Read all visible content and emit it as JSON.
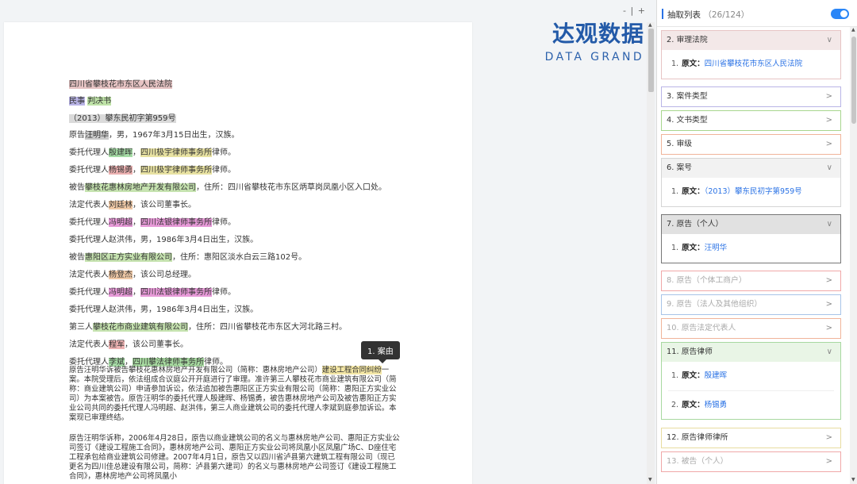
{
  "viewer": {
    "zoom_out": "-",
    "zoom_sep": "|",
    "zoom_in": "+",
    "brand_cn": "达观数据",
    "brand_en": "DATA GRAND",
    "tooltip": "1. 案由"
  },
  "document": {
    "court": "四川省攀枝花市东区人民法院",
    "type_a": "民事",
    "type_b": "判决书",
    "case_no": "（2013）攀东民初字第959号",
    "lines": [
      {
        "pre": "原告",
        "hl": "汪明华",
        "post": "，男，1967年3月15日出生，汉族。"
      },
      {
        "pre": "委托代理人",
        "hl": "殷建晖",
        "mid": "，",
        "hl2": "四川极宇律师事务所",
        "post": "律师。"
      },
      {
        "pre": "委托代理人",
        "hl": "杨锡勇",
        "mid": "，",
        "hl2": "四川极宇律师事务所",
        "post": "律师。"
      },
      {
        "pre": "被告",
        "hl": "攀枝花惠林房地产开发有限公司",
        "post": "，住所：四川省攀枝花市东区炳草岗凤凰小区入口处。"
      },
      {
        "pre": "法定代表人",
        "hl": "刘廷林",
        "post": "，该公司董事长。"
      },
      {
        "pre": "委托代理人",
        "hl": "冯明超",
        "mid": "，",
        "hl2": "四川法银律师事务所",
        "post": "律师。"
      },
      {
        "pre": "委托代理人赵洪伟，男，1986年3月4日出生，汉族。"
      },
      {
        "pre": "被告",
        "hl": "惠阳区正方实业有限公司",
        "post": "，住所：惠阳区淡水白云三路102号。"
      },
      {
        "pre": "法定代表人",
        "hl": "杨登杰",
        "post": "，该公司总经理。"
      },
      {
        "pre": "委托代理人",
        "hl": "冯明超",
        "mid": "，",
        "hl2": "四川法银律师事务所",
        "post": "律师。"
      },
      {
        "pre": "委托代理人赵洪伟，男，1986年3月4日出生，汉族。"
      },
      {
        "pre": "第三人",
        "hl": "攀枝花市商业建筑有限公司",
        "post": "，住所：四川省攀枝花市东区大河北路三村。"
      },
      {
        "pre": "法定代表人",
        "hl": "程军",
        "post": "，该公司董事长。"
      },
      {
        "pre": "委托代理人",
        "hl": "李斌",
        "mid": "，",
        "hl2": "四川攀法律师事务所",
        "post": "律师。"
      }
    ],
    "para1_pre": "原告汪明华诉被告攀枝花惠林房地产开发有限公司（简称：惠林房地产公司）",
    "para1_hl": "建设工程合同纠纷",
    "para1_post": "一案。本院受理后，依法组成合议庭公开开庭进行了审理。准许第三人攀枝花市商业建筑有限公司（简称：商业建筑公司）申请参加诉讼，依法追加被告惠阳区正方实业有限公司（简称：惠阳正方实业公司）为本案被告。原告汪明华的委托代理人殷建晖、杨锡勇，被告惠林房地产公司及被告惠阳正方实业公司共同的委托代理人冯明超、赵洪伟，第三人商业建筑公司的委托代理人李斌到庭参加诉讼。本案现已审理终结。",
    "para2": "原告汪明华诉称，2006年4月28日，原告以商业建筑公司的名义与惠林房地产公司、惠阳正方实业公司签订《建设工程施工合同》，惠林房地产公司、惠阳正方实业公司将凤凰小区凤凰广场C、D座住宅工程承包给商业建筑公司修建。2007年4月1日，原告又以四川省泸县第六建筑工程有限公司（现已更名为四川佳总建设有限公司，简称：泸县第六建司）的名义与惠林房地产公司签订《建设工程施工合同》，惠林房地产公司将凤凰小"
  },
  "panel": {
    "title": "抽取列表",
    "count": "（26/124）",
    "key_label": "原文：",
    "cards": [
      {
        "label": "2. 审理法院",
        "expanded": true,
        "color": "#e7c4c4",
        "head_bg": "#f3e8e8",
        "items": [
          {
            "index": "1.",
            "value": "四川省攀枝花市东区人民法院"
          }
        ]
      },
      {
        "label": "3. 案件类型",
        "expanded": false,
        "color": "#b9b4e6"
      },
      {
        "label": "4. 文书类型",
        "expanded": false,
        "color": "#a8d68e"
      },
      {
        "label": "5. 审级",
        "expanded": false,
        "color": "#f0b49a"
      },
      {
        "label": "6. 案号",
        "expanded": true,
        "color": "#d5d5d5",
        "head_bg": "#f2f2f2",
        "items": [
          {
            "index": "1.",
            "value": "（2013）攀东民初字第959号"
          }
        ]
      },
      {
        "label": "7. 原告（个人）",
        "expanded": true,
        "color": "#777777",
        "head_bg": "#e1e1e1",
        "items": [
          {
            "index": "1.",
            "value": "汪明华"
          }
        ]
      },
      {
        "label": "8. 原告（个体工商户）",
        "expanded": false,
        "color": "#f0a8a8",
        "dim": true
      },
      {
        "label": "9. 原告（法人及其他组织）",
        "expanded": false,
        "color": "#a8c4e8",
        "dim": true
      },
      {
        "label": "10. 原告法定代表人",
        "expanded": false,
        "color": "#f0b49a",
        "dim": true
      },
      {
        "label": "11. 原告律师",
        "expanded": true,
        "color": "#a8d8a0",
        "head_bg": "#e9f5e6",
        "items": [
          {
            "index": "1.",
            "value": "殷建晖"
          },
          {
            "index": "2.",
            "value": "杨锡勇"
          }
        ]
      },
      {
        "label": "12. 原告律师律所",
        "expanded": false,
        "color": "#e8dca0"
      },
      {
        "label": "13. 被告（个人）",
        "expanded": false,
        "color": "#f0a8a8",
        "dim": true
      }
    ],
    "icons": {
      "toggle": "toggle-switch-icon",
      "chevron_down": "chevron-down-icon",
      "chevron_right": "chevron-right-icon"
    },
    "accent": "#2a72e5"
  }
}
